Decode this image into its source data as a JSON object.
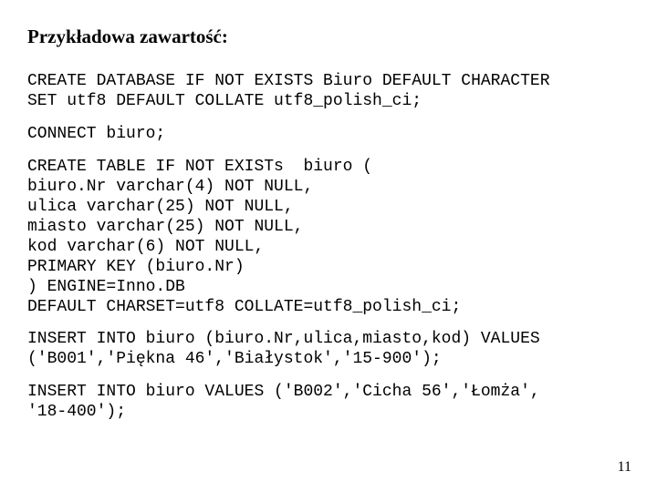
{
  "heading": "Przykładowa zawartość:",
  "code_blocks": {
    "b1": "CREATE DATABASE IF NOT EXISTS Biuro DEFAULT CHARACTER\nSET utf8 DEFAULT COLLATE utf8_polish_ci;",
    "b2": "CONNECT biuro;",
    "b3": "CREATE TABLE IF NOT EXISTs  biuro (\nbiuro.Nr varchar(4) NOT NULL,\nulica varchar(25) NOT NULL,\nmiasto varchar(25) NOT NULL,\nkod varchar(6) NOT NULL,\nPRIMARY KEY (biuro.Nr)\n) ENGINE=Inno.DB\nDEFAULT CHARSET=utf8 COLLATE=utf8_polish_ci;",
    "b4": "INSERT INTO biuro (biuro.Nr,ulica,miasto,kod) VALUES\n('B001','Piękna 46','Białystok','15-900');",
    "b5": "INSERT INTO biuro VALUES ('B002','Cicha 56','Łomża',\n'18-400');"
  },
  "page_number": "11"
}
